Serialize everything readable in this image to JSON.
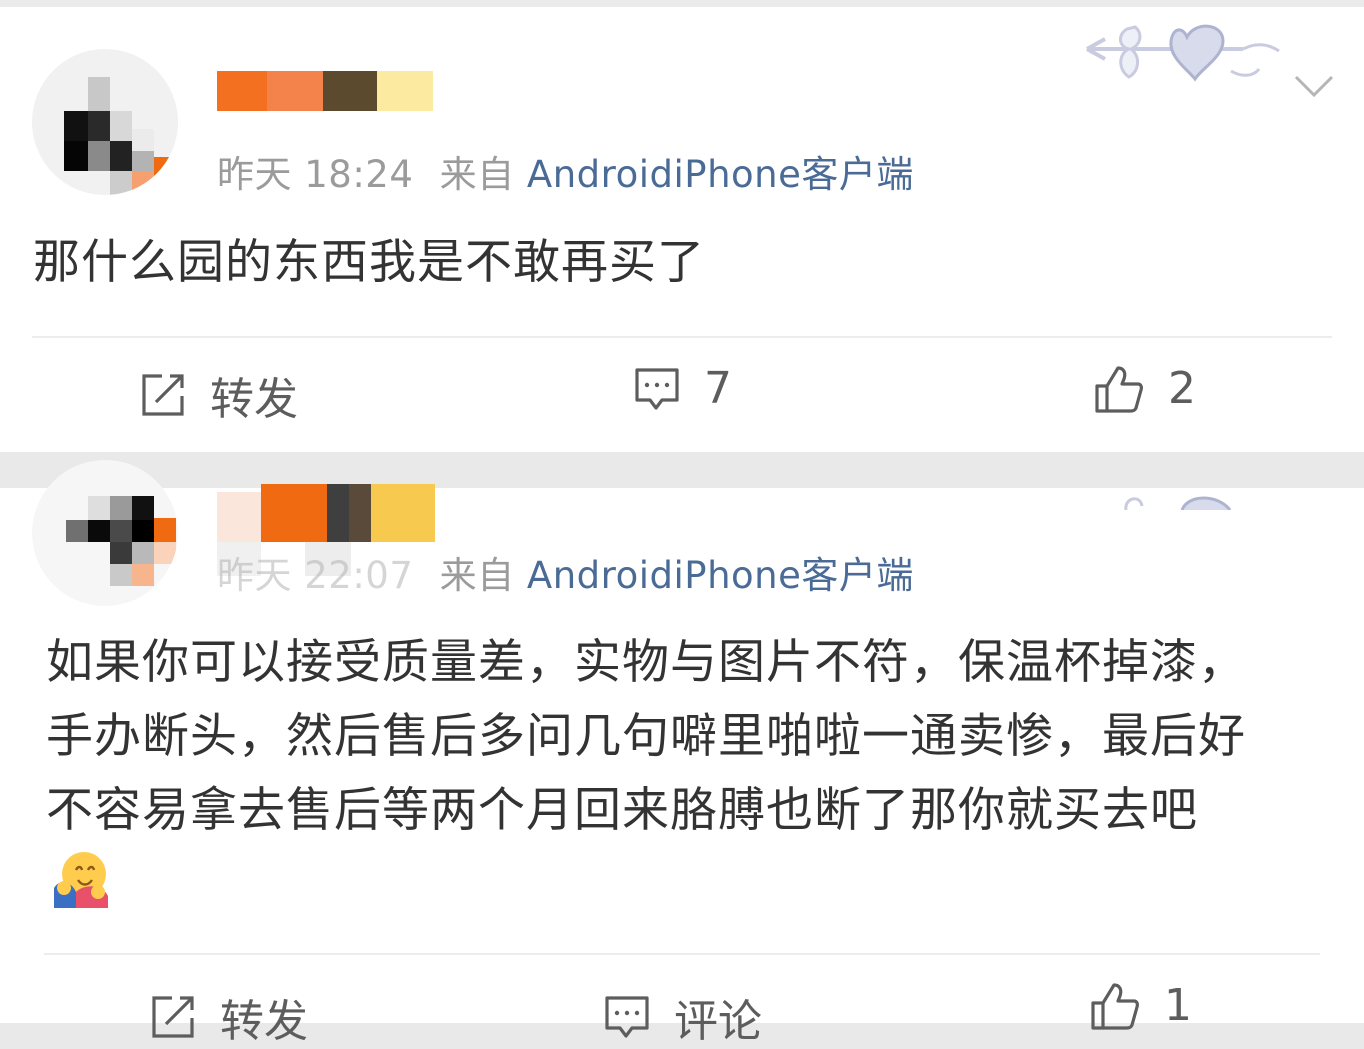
{
  "post1": {
    "time": "昨天 18:24",
    "source_prefix": "来自",
    "source_name": "AndroidiPhone客户端",
    "content": "那什么园的东西我是不敢再买了",
    "actions": {
      "repost_label": "转发",
      "comment_count": "7",
      "like_count": "2"
    }
  },
  "post2": {
    "time": "昨天 22:07",
    "source_prefix": "来自",
    "source_name": "AndroidiPhone客户端",
    "content_lines": [
      "如果你可以接受质量差，实物与图片不符，保温杯掉漆，",
      "手办断头，然后售后多问几句噼里啪啦一通卖惨，最后好",
      "不容易拿去售后等两个月回来胳膊也断了那你就买去吧"
    ],
    "actions": {
      "repost_label": "转发",
      "comment_label": "评论",
      "like_count": "1"
    }
  },
  "icons": {
    "repost": "repost-icon",
    "comment": "comment-icon",
    "like": "thumbs-up-icon",
    "more": "chevron-down-icon",
    "emoji": "hugging-face-emoji",
    "badge": "arrow-heart-badge"
  },
  "colors": {
    "source_link": "#4b6b97",
    "meta_gray": "#9b9b9b",
    "text": "#333333"
  }
}
